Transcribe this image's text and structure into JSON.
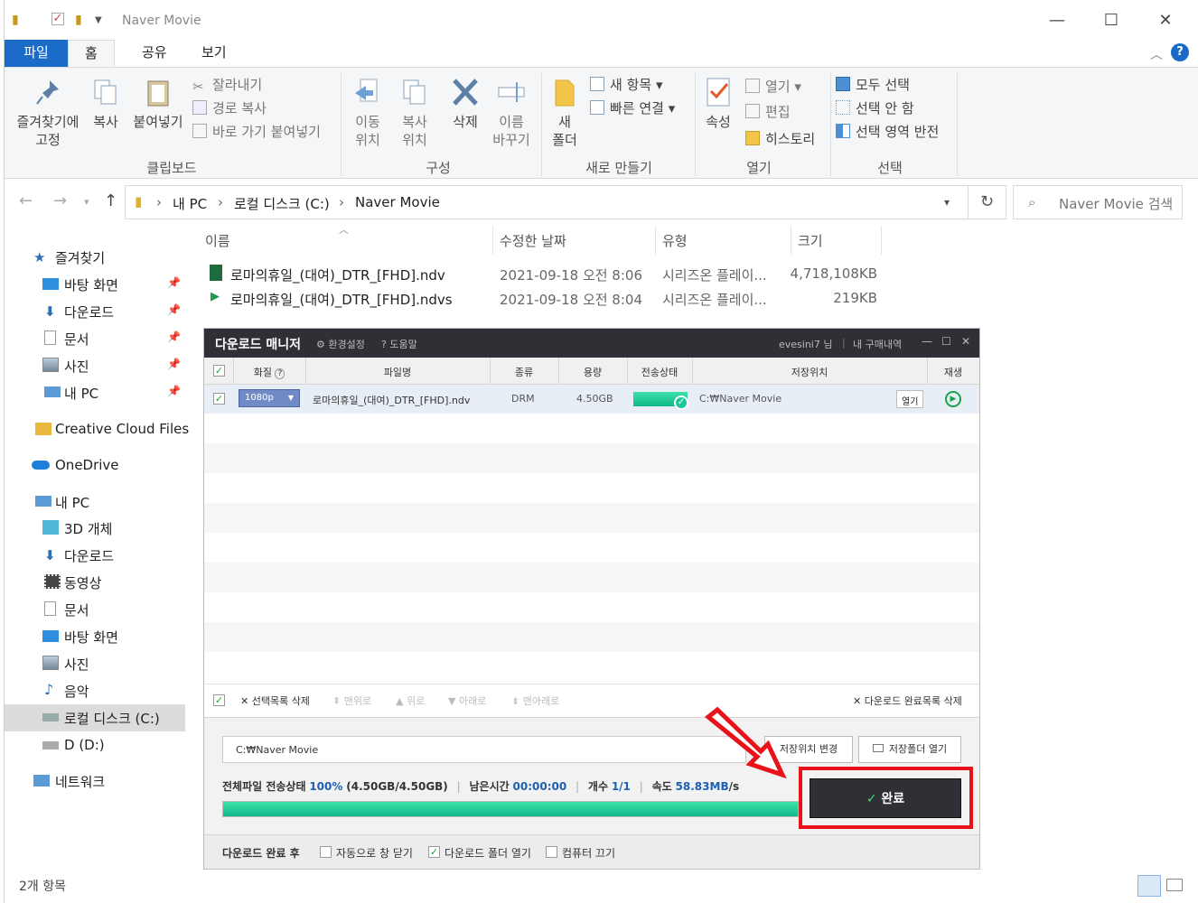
{
  "window": {
    "title": "Naver Movie"
  },
  "ribbon_tabs": [
    "파일",
    "홈",
    "공유",
    "보기"
  ],
  "ribbon": {
    "clipboard": {
      "pin": "즐겨찾기에\n고정",
      "copy": "복사",
      "paste": "붙여넣기",
      "cut": "잘라내기",
      "copy_path": "경로 복사",
      "paste_shortcut": "바로 가기 붙여넣기",
      "group": "클립보드"
    },
    "organize": {
      "move_to": "이동\n위치",
      "copy_to": "복사\n위치",
      "delete": "삭제",
      "rename": "이름\n바꾸기",
      "group": "구성"
    },
    "new": {
      "new_folder": "새\n폴더",
      "new_item": "새 항목",
      "easy_access": "빠른 연결",
      "group": "새로 만들기"
    },
    "open": {
      "properties": "속성",
      "open": "열기",
      "edit": "편집",
      "history": "히스토리",
      "group": "열기"
    },
    "select": {
      "select_all": "모두 선택",
      "select_none": "선택 안 함",
      "invert": "선택 영역 반전",
      "group": "선택"
    }
  },
  "address": {
    "crumbs": [
      "내 PC",
      "로컬 디스크 (C:)",
      "Naver Movie"
    ],
    "search_placeholder": "Naver Movie 검색"
  },
  "nav": {
    "quick_access": "즐겨찾기",
    "qa_items": [
      "바탕 화면",
      "다운로드",
      "문서",
      "사진",
      "내 PC"
    ],
    "creative_cloud": "Creative Cloud Files",
    "onedrive": "OneDrive",
    "this_pc": "내 PC",
    "pc_items": [
      "3D 개체",
      "다운로드",
      "동영상",
      "문서",
      "바탕 화면",
      "사진",
      "음악",
      "로컬 디스크 (C:)",
      "D (D:)"
    ],
    "network": "네트워크"
  },
  "columns": [
    "이름",
    "수정한 날짜",
    "유형",
    "크기"
  ],
  "files": [
    {
      "name": "로마의휴일_(대여)_DTR_[FHD].ndv",
      "date": "2021-09-18 오전 8:06",
      "type": "시리즈온 플레이...",
      "size": "4,718,108KB"
    },
    {
      "name": "로마의휴일_(대여)_DTR_[FHD].ndvs",
      "date": "2021-09-18 오전 8:04",
      "type": "시리즈온 플레이...",
      "size": "219KB"
    }
  ],
  "dm": {
    "title": "다운로드 매니저",
    "settings": "⚙ 환경설정",
    "help": "? 도움말",
    "user": "evesini7 님",
    "purchases": "내 구매내역",
    "cols": [
      "화질",
      "파일명",
      "종류",
      "용량",
      "전송상태",
      "저장위치",
      "재생"
    ],
    "row": {
      "quality": "1080p",
      "filename": "로마의휴일_(대여)_DTR_[FHD].ndv",
      "kind": "DRM",
      "size": "4.50GB",
      "progress": 1.0,
      "location": "C:₩Naver Movie",
      "open": "열기"
    },
    "toolbar": {
      "delete_selected": "✕ 선택목록 삭제",
      "top": "⇞ 맨위로",
      "up": "▲ 위로",
      "down": "▼ 아래로",
      "bottom": "⇟ 맨아래로",
      "clear_done": "✕ 다운로드 완료목록 삭제"
    },
    "path": "C:₩Naver Movie",
    "change_loc": "저장위치 변경",
    "open_folder": "저장폴더 열기",
    "status": {
      "label": "전체파일 전송상태",
      "percent": "100%",
      "bytes": "(4.50GB/4.50GB)",
      "remain_label": "남은시간",
      "remain": "00:00:00",
      "count_label": "개수",
      "count": "1/1",
      "speed_label": "속도",
      "speed": "58.83MB",
      "speed_unit": "/s"
    },
    "overall_progress": 1.0,
    "done": "완료",
    "after": {
      "label": "다운로드 완료 후",
      "auto_close": "자동으로 창 닫기",
      "open_folder": "다운로드 폴더 열기",
      "shutdown": "컴퓨터 끄기"
    }
  },
  "statusbar": {
    "count": "2개 항목"
  },
  "colors": {
    "accent": "#1a6bc7",
    "dm_header": "#2e3036",
    "highlight": "#e8121a",
    "progress": "#1cc796"
  }
}
